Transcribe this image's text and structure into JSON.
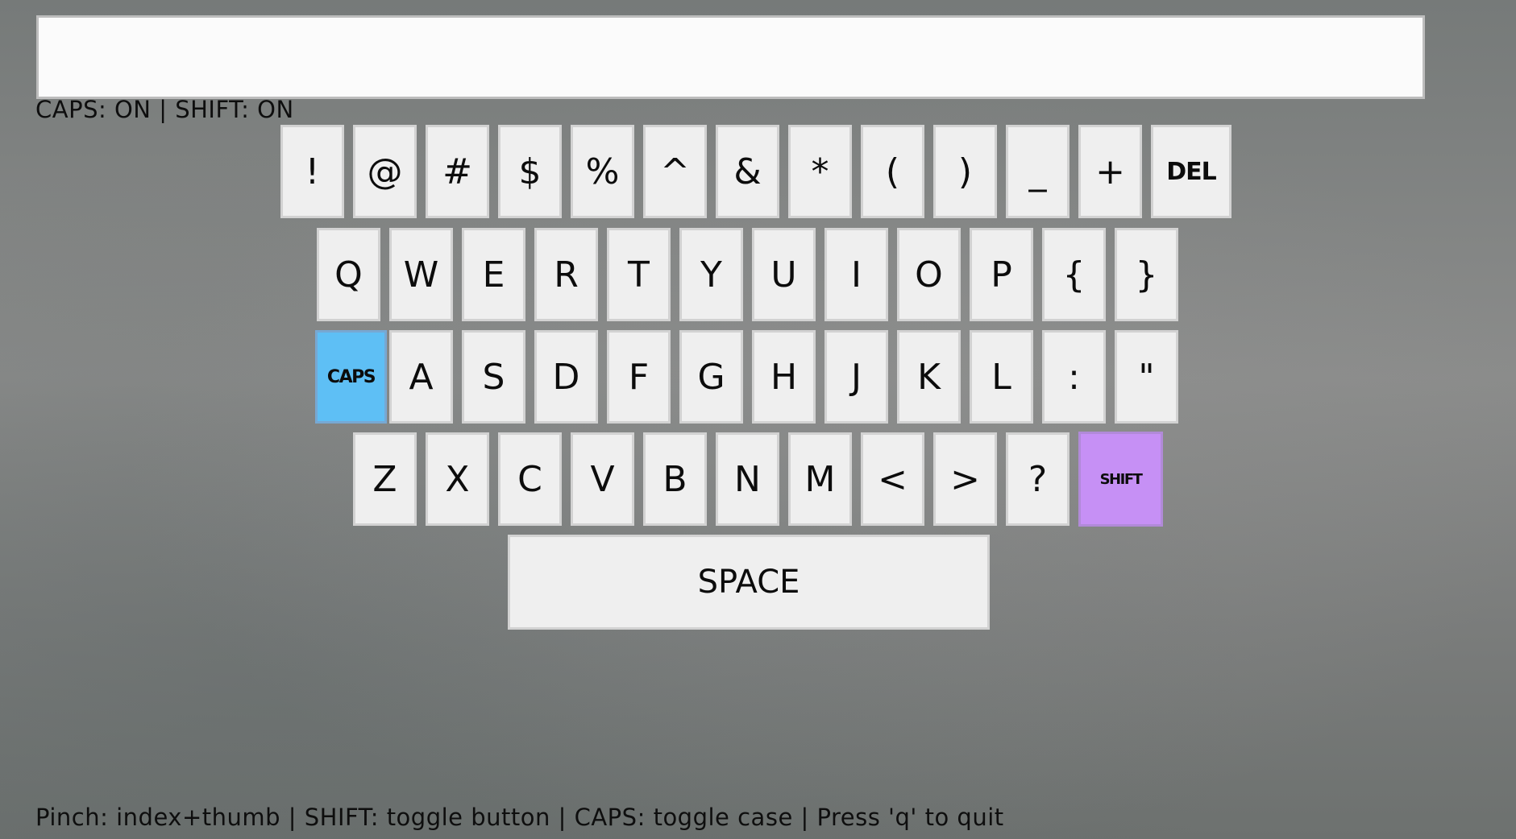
{
  "text_display": {
    "value": ""
  },
  "status": {
    "text": "CAPS: ON | SHIFT: ON"
  },
  "help": {
    "text": "Pinch: index+thumb | SHIFT: toggle button | CAPS: toggle case | Press 'q' to quit"
  },
  "colors": {
    "caps_active": "#5ebff5",
    "shift_active": "#c690f5",
    "key_bg": "#efefef"
  },
  "keyboard": {
    "row1": [
      "!",
      "@",
      "#",
      "$",
      "%",
      "^",
      "&",
      "*",
      "(",
      ")",
      "_",
      "+",
      "DEL"
    ],
    "row2": [
      "Q",
      "W",
      "E",
      "R",
      "T",
      "Y",
      "U",
      "I",
      "O",
      "P",
      "{",
      "}"
    ],
    "row3": [
      "CAPS",
      "A",
      "S",
      "D",
      "F",
      "G",
      "H",
      "J",
      "K",
      "L",
      ":",
      "\""
    ],
    "row4": [
      "Z",
      "X",
      "C",
      "V",
      "B",
      "N",
      "M",
      "<",
      ">",
      "?",
      "SHIFT"
    ],
    "space_label": "SPACE"
  }
}
